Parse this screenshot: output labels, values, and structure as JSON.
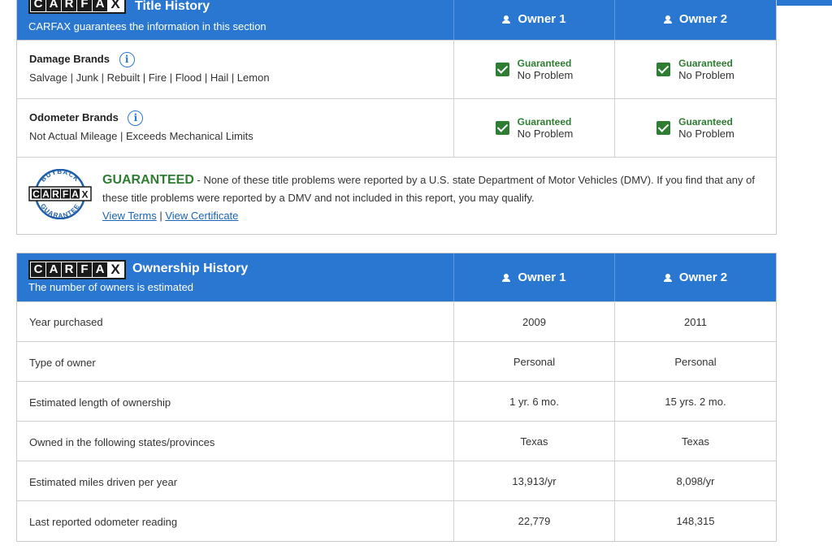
{
  "title_history": {
    "title": "Title History",
    "subtitle": "CARFAX guarantees the information in this section",
    "owners": [
      "Owner 1",
      "Owner 2"
    ],
    "rows": [
      {
        "name": "Damage Brands",
        "desc": "Salvage | Junk | Rebuilt | Fire | Flood | Hail | Lemon",
        "status": [
          {
            "top": "Guaranteed",
            "bottom": "No Problem"
          },
          {
            "top": "Guaranteed",
            "bottom": "No Problem"
          }
        ]
      },
      {
        "name": "Odometer Brands",
        "desc": "Not Actual Mileage | Exceeds Mechanical Limits",
        "status": [
          {
            "top": "Guaranteed",
            "bottom": "No Problem"
          },
          {
            "top": "Guaranteed",
            "bottom": "No Problem"
          }
        ]
      }
    ],
    "guarantee": {
      "word": "GUARANTEED",
      "text": " - None of these title problems were reported by a U.S. state Department of Motor Vehicles (DMV). If you find that any of these title problems were reported by a DMV and not included in this report, you may qualify.",
      "link1": "View Terms",
      "sep": " | ",
      "link2": "View Certificate",
      "badge_top": "BUYBACK",
      "badge_bottom": "GUARANTEE"
    }
  },
  "ownership_history": {
    "title": "Ownership History",
    "subtitle": "The number of owners is estimated",
    "owners": [
      "Owner 1",
      "Owner 2"
    ],
    "rows": [
      {
        "label": "Year purchased",
        "values": [
          "2009",
          "2011"
        ]
      },
      {
        "label": "Type of owner",
        "values": [
          "Personal",
          "Personal"
        ]
      },
      {
        "label": "Estimated length of ownership",
        "values": [
          "1 yr. 6 mo.",
          "15 yrs. 2 mo."
        ]
      },
      {
        "label": "Owned in the following states/provinces",
        "values": [
          "Texas",
          "Texas"
        ]
      },
      {
        "label": "Estimated miles driven per year",
        "values": [
          "13,913/yr",
          "8,098/yr"
        ]
      },
      {
        "label": "Last reported odometer reading",
        "values": [
          "22,779",
          "148,315"
        ]
      }
    ]
  },
  "logo": {
    "letters": [
      "C",
      "A",
      "R",
      "F",
      "A",
      "X"
    ]
  },
  "colors": {
    "header_blue": "#2a77d1",
    "guarantee_green": "#2e7d32",
    "link_blue": "#1a64b8"
  },
  "icons": [
    "person-icon",
    "info-icon",
    "checkbox-checked-icon",
    "buyback-guarantee-badge"
  ]
}
